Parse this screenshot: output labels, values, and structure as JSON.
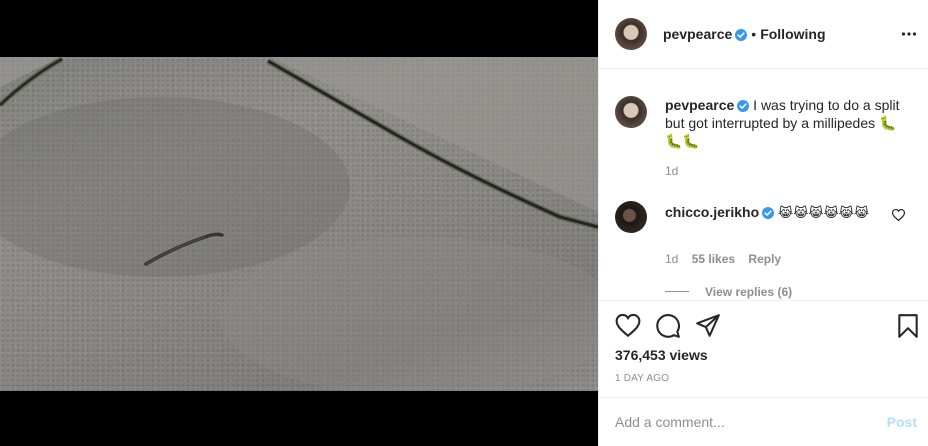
{
  "post": {
    "author": {
      "username": "pevpearce",
      "verified": true,
      "follow_status": "Following",
      "separator": "•"
    },
    "caption": {
      "username": "pevpearce",
      "text": "I was trying to do a split but got interrupted by a millipedes 🐛🐛🐛",
      "age": "1d"
    },
    "comments": [
      {
        "username": "chicco.jerikho",
        "verified": true,
        "text": "😹😹😹😹😹😹",
        "age": "1d",
        "likes": "55 likes",
        "reply_label": "Reply",
        "view_replies": "View replies (6)"
      }
    ],
    "views": "376,453 views",
    "posted": "1 DAY AGO"
  },
  "comment_box": {
    "placeholder": "Add a comment...",
    "post_label": "Post"
  },
  "icons": {
    "like": "heart-icon",
    "comment": "comment-bubble-icon",
    "share": "paper-plane-icon",
    "save": "bookmark-icon",
    "more": "more-dots-icon",
    "verified": "verified-badge-icon"
  },
  "colors": {
    "verified_blue": "#3897f0",
    "post_button_disabled": "#b2dffc",
    "muted_text": "#8e8e8e"
  }
}
